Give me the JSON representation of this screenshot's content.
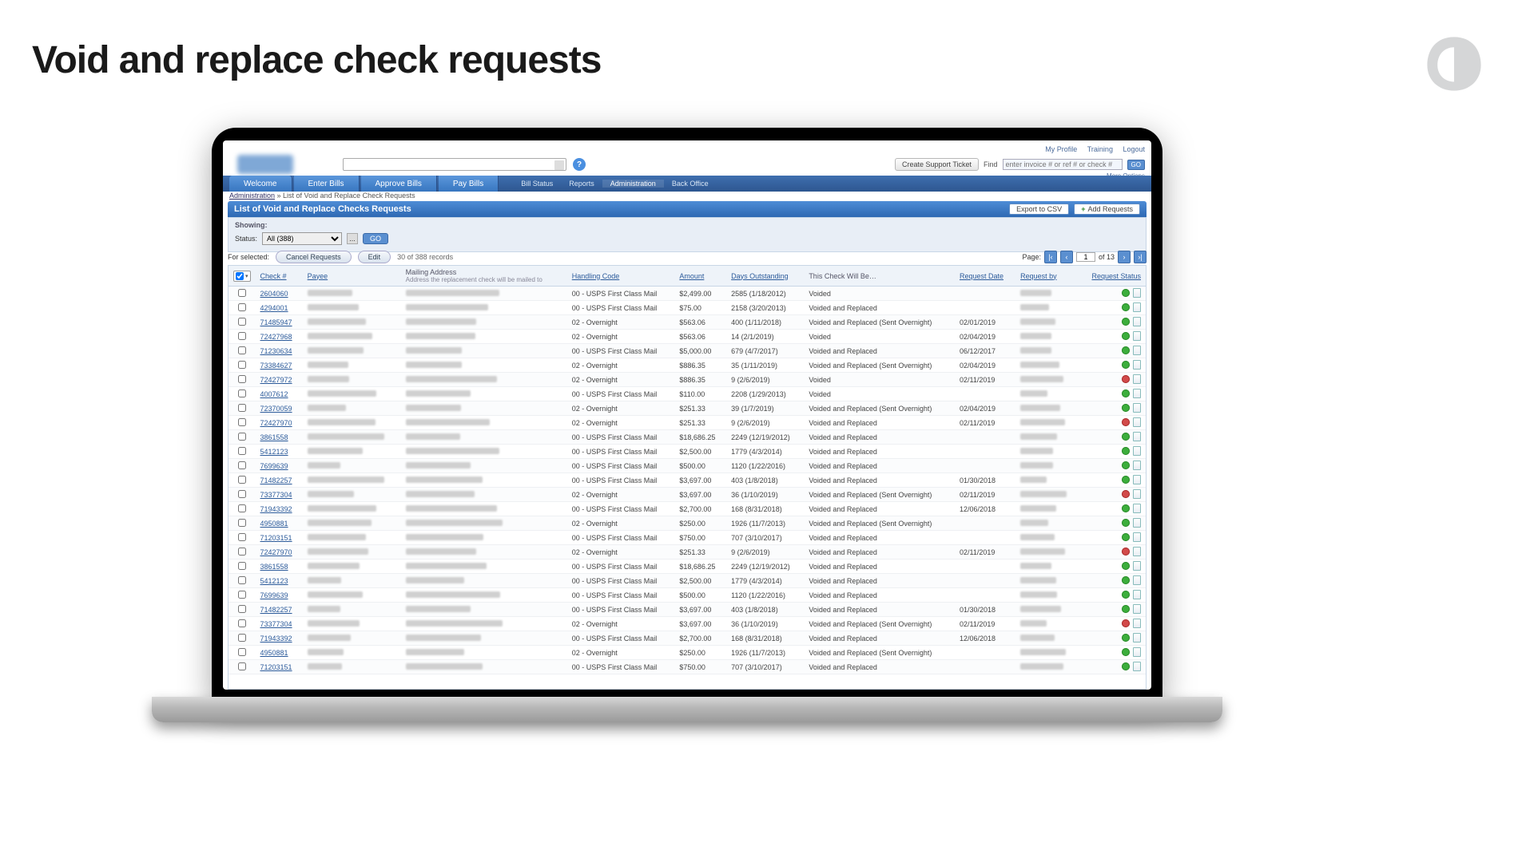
{
  "slide_title": "Void and replace check requests",
  "top_links": {
    "profile": "My Profile",
    "training": "Training",
    "logout": "Logout"
  },
  "support_btn": "Create Support Ticket",
  "find": {
    "label": "Find",
    "placeholder": "enter invoice # or ref # or check #",
    "go": "GO",
    "more": "More Options"
  },
  "nav_tabs": {
    "welcome": "Welcome",
    "enter": "Enter Bills",
    "approve": "Approve Bills",
    "pay": "Pay Bills"
  },
  "nav_sub": {
    "billstatus": "Bill Status",
    "reports": "Reports",
    "admin": "Administration",
    "backoffice": "Back Office"
  },
  "breadcrumb": {
    "admin": "Administration",
    "sep": " » ",
    "page": "List of Void and Replace Check Requests"
  },
  "panel": {
    "title": "List of Void and Replace Checks Requests",
    "export": "Export to CSV",
    "add": "Add Requests"
  },
  "filter": {
    "showing": "Showing:",
    "status_lbl": "Status:",
    "status_val": "All (388)",
    "go": "GO"
  },
  "actions": {
    "for_selected": "For selected:",
    "cancel": "Cancel Requests",
    "edit": "Edit",
    "count": "30 of 388 records"
  },
  "pager": {
    "label": "Page:",
    "cur": "1",
    "of": "of 13"
  },
  "columns": {
    "check": "Check #",
    "payee": "Payee",
    "mailing": "Mailing Address",
    "mailing_sub": "Address the replacement check will be mailed to",
    "handling": "Handling Code",
    "amount": "Amount",
    "days": "Days Outstanding",
    "action": "This Check Will Be…",
    "reqdate": "Request Date",
    "reqby": "Request by",
    "status": "Request Status"
  },
  "rows": [
    {
      "ck": "2604060",
      "hc": "00 - USPS First Class Mail",
      "amt": "$2,499.00",
      "days": "2585 (1/18/2012)",
      "act": "Voided",
      "rd": "",
      "st": "g"
    },
    {
      "ck": "4294001",
      "hc": "00 - USPS First Class Mail",
      "amt": "$75.00",
      "days": "2158 (3/20/2013)",
      "act": "Voided and Replaced",
      "rd": "",
      "st": "g"
    },
    {
      "ck": "71485947",
      "hc": "02 - Overnight",
      "amt": "$563.06",
      "days": "400 (1/11/2018)",
      "act": "Voided and Replaced (Sent Overnight)",
      "rd": "02/01/2019",
      "st": "g"
    },
    {
      "ck": "72427968",
      "hc": "02 - Overnight",
      "amt": "$563.06",
      "days": "14 (2/1/2019)",
      "act": "Voided",
      "rd": "02/04/2019",
      "st": "g"
    },
    {
      "ck": "71230634",
      "hc": "00 - USPS First Class Mail",
      "amt": "$5,000.00",
      "days": "679 (4/7/2017)",
      "act": "Voided and Replaced",
      "rd": "06/12/2017",
      "st": "g"
    },
    {
      "ck": "73384627",
      "hc": "02 - Overnight",
      "amt": "$886.35",
      "days": "35 (1/11/2019)",
      "act": "Voided and Replaced (Sent Overnight)",
      "rd": "02/04/2019",
      "st": "g"
    },
    {
      "ck": "72427972",
      "hc": "02 - Overnight",
      "amt": "$886.35",
      "days": "9 (2/6/2019)",
      "act": "Voided",
      "rd": "02/11/2019",
      "st": "r"
    },
    {
      "ck": "4007612",
      "hc": "00 - USPS First Class Mail",
      "amt": "$110.00",
      "days": "2208 (1/29/2013)",
      "act": "Voided",
      "rd": "",
      "st": "g"
    },
    {
      "ck": "72370059",
      "hc": "02 - Overnight",
      "amt": "$251.33",
      "days": "39 (1/7/2019)",
      "act": "Voided and Replaced (Sent Overnight)",
      "rd": "02/04/2019",
      "st": "g"
    },
    {
      "ck": "72427970",
      "hc": "02 - Overnight",
      "amt": "$251.33",
      "days": "9 (2/6/2019)",
      "act": "Voided and Replaced",
      "rd": "02/11/2019",
      "st": "r"
    },
    {
      "ck": "3861558",
      "hc": "00 - USPS First Class Mail",
      "amt": "$18,686.25",
      "days": "2249 (12/19/2012)",
      "act": "Voided and Replaced",
      "rd": "",
      "st": "g"
    },
    {
      "ck": "5412123",
      "hc": "00 - USPS First Class Mail",
      "amt": "$2,500.00",
      "days": "1779 (4/3/2014)",
      "act": "Voided and Replaced",
      "rd": "",
      "st": "g"
    },
    {
      "ck": "7699639",
      "hc": "00 - USPS First Class Mail",
      "amt": "$500.00",
      "days": "1120 (1/22/2016)",
      "act": "Voided and Replaced",
      "rd": "",
      "st": "g"
    },
    {
      "ck": "71482257",
      "hc": "00 - USPS First Class Mail",
      "amt": "$3,697.00",
      "days": "403 (1/8/2018)",
      "act": "Voided and Replaced",
      "rd": "01/30/2018",
      "st": "g"
    },
    {
      "ck": "73377304",
      "hc": "02 - Overnight",
      "amt": "$3,697.00",
      "days": "36 (1/10/2019)",
      "act": "Voided and Replaced (Sent Overnight)",
      "rd": "02/11/2019",
      "st": "r"
    },
    {
      "ck": "71943392",
      "hc": "00 - USPS First Class Mail",
      "amt": "$2,700.00",
      "days": "168 (8/31/2018)",
      "act": "Voided and Replaced",
      "rd": "12/06/2018",
      "st": "g"
    },
    {
      "ck": "4950881",
      "hc": "02 - Overnight",
      "amt": "$250.00",
      "days": "1926 (11/7/2013)",
      "act": "Voided and Replaced (Sent Overnight)",
      "rd": "",
      "st": "g"
    },
    {
      "ck": "71203151",
      "hc": "00 - USPS First Class Mail",
      "amt": "$750.00",
      "days": "707 (3/10/2017)",
      "act": "Voided and Replaced",
      "rd": "",
      "st": "g"
    },
    {
      "ck": "72427970",
      "hc": "02 - Overnight",
      "amt": "$251.33",
      "days": "9 (2/6/2019)",
      "act": "Voided and Replaced",
      "rd": "02/11/2019",
      "st": "r"
    },
    {
      "ck": "3861558",
      "hc": "00 - USPS First Class Mail",
      "amt": "$18,686.25",
      "days": "2249 (12/19/2012)",
      "act": "Voided and Replaced",
      "rd": "",
      "st": "g"
    },
    {
      "ck": "5412123",
      "hc": "00 - USPS First Class Mail",
      "amt": "$2,500.00",
      "days": "1779 (4/3/2014)",
      "act": "Voided and Replaced",
      "rd": "",
      "st": "g"
    },
    {
      "ck": "7699639",
      "hc": "00 - USPS First Class Mail",
      "amt": "$500.00",
      "days": "1120 (1/22/2016)",
      "act": "Voided and Replaced",
      "rd": "",
      "st": "g"
    },
    {
      "ck": "71482257",
      "hc": "00 - USPS First Class Mail",
      "amt": "$3,697.00",
      "days": "403 (1/8/2018)",
      "act": "Voided and Replaced",
      "rd": "01/30/2018",
      "st": "g"
    },
    {
      "ck": "73377304",
      "hc": "02 - Overnight",
      "amt": "$3,697.00",
      "days": "36 (1/10/2019)",
      "act": "Voided and Replaced (Sent Overnight)",
      "rd": "02/11/2019",
      "st": "r"
    },
    {
      "ck": "71943392",
      "hc": "00 - USPS First Class Mail",
      "amt": "$2,700.00",
      "days": "168 (8/31/2018)",
      "act": "Voided and Replaced",
      "rd": "12/06/2018",
      "st": "g"
    },
    {
      "ck": "4950881",
      "hc": "02 - Overnight",
      "amt": "$250.00",
      "days": "1926 (11/7/2013)",
      "act": "Voided and Replaced (Sent Overnight)",
      "rd": "",
      "st": "g"
    },
    {
      "ck": "71203151",
      "hc": "00 - USPS First Class Mail",
      "amt": "$750.00",
      "days": "707 (3/10/2017)",
      "act": "Voided and Replaced",
      "rd": "",
      "st": "g"
    }
  ]
}
